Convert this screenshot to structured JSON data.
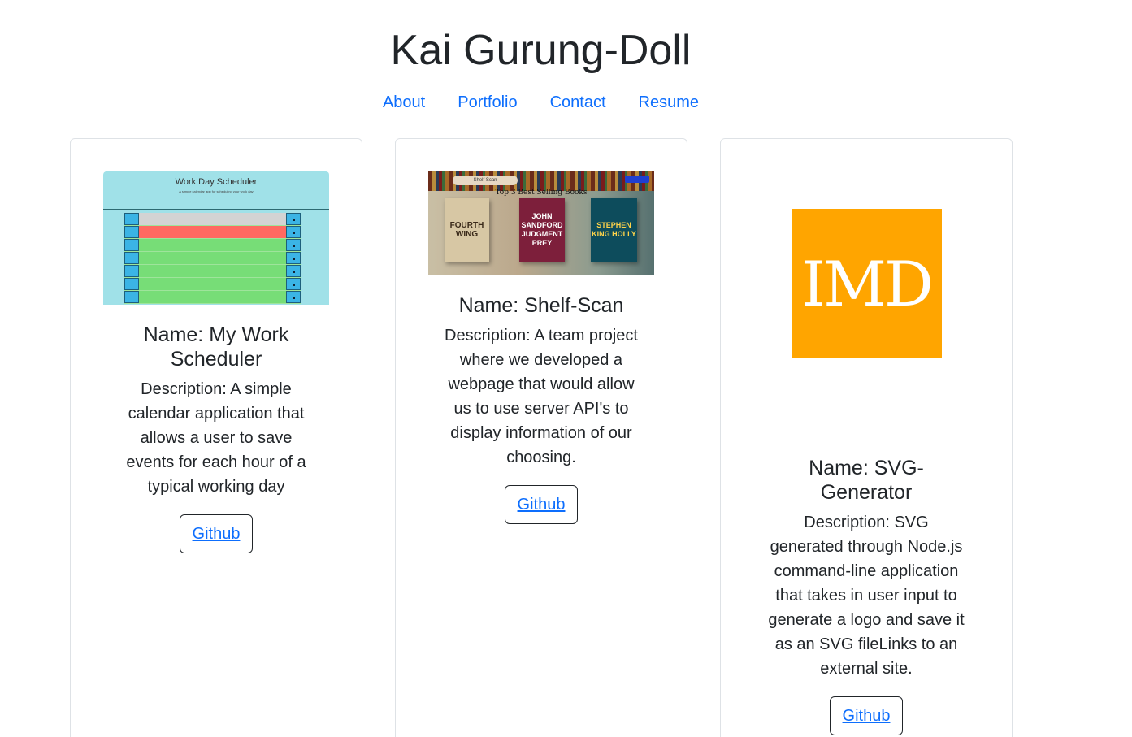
{
  "header": {
    "title": "Kai Gurung-Doll"
  },
  "nav": {
    "items": [
      "About",
      "Portfolio",
      "Contact",
      "Resume"
    ]
  },
  "colors": {
    "link": "#0d6efd",
    "text": "#212529",
    "border": "#dee2e6",
    "logo_bg": "#ffa500"
  },
  "projects": [
    {
      "name": "Name: My Work Scheduler",
      "description": "Description: A simple calendar application that allows a user to save events for each hour of a typical working day",
      "button": "Github",
      "thumbnail": {
        "title": "Work Day Scheduler",
        "subtitle": "A simple calendar app for scheduling your work day"
      }
    },
    {
      "name": "Name: Shelf-Scan",
      "description": "Description: A team project where we developed a webpage that would allow us to use server API's to display information of our choosing.",
      "button": "Github",
      "thumbnail": {
        "logo": "Shelf Scan",
        "heading": "Top 3 Best Selling Books",
        "books": [
          "FOURTH WING",
          "JOHN SANDFORD JUDGMENT PREY",
          "STEPHEN KING HOLLY"
        ]
      }
    },
    {
      "name": "Name: SVG-Generator",
      "description": "Description: SVG generated through Node.js command-line application that takes in user input to generate a logo and save it as an SVG fileLinks to an external site.",
      "button": "Github",
      "thumbnail": {
        "logo_text": "IMD"
      }
    }
  ]
}
